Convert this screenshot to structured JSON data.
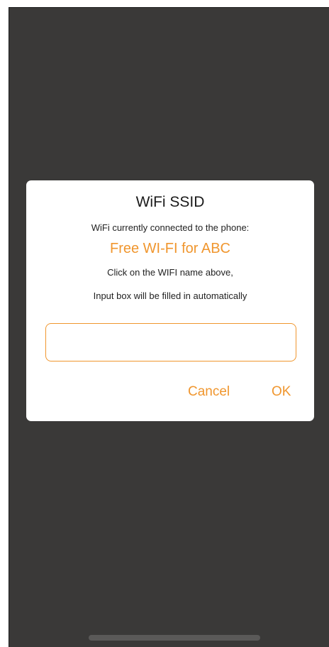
{
  "dialog": {
    "title": "WiFi SSID",
    "subtitle": "WiFi currently connected to the phone:",
    "wifi_name": "Free WI-FI for ABC",
    "hint_line1": "Click on the WIFI name above,",
    "hint_line2": "Input box will be filled in automatically",
    "input": {
      "value": "",
      "placeholder": ""
    },
    "cancel_label": "Cancel",
    "ok_label": "OK"
  },
  "colors": {
    "accent": "#f0962e",
    "backdrop": "#3a3938",
    "dialog_bg": "#ffffff"
  }
}
